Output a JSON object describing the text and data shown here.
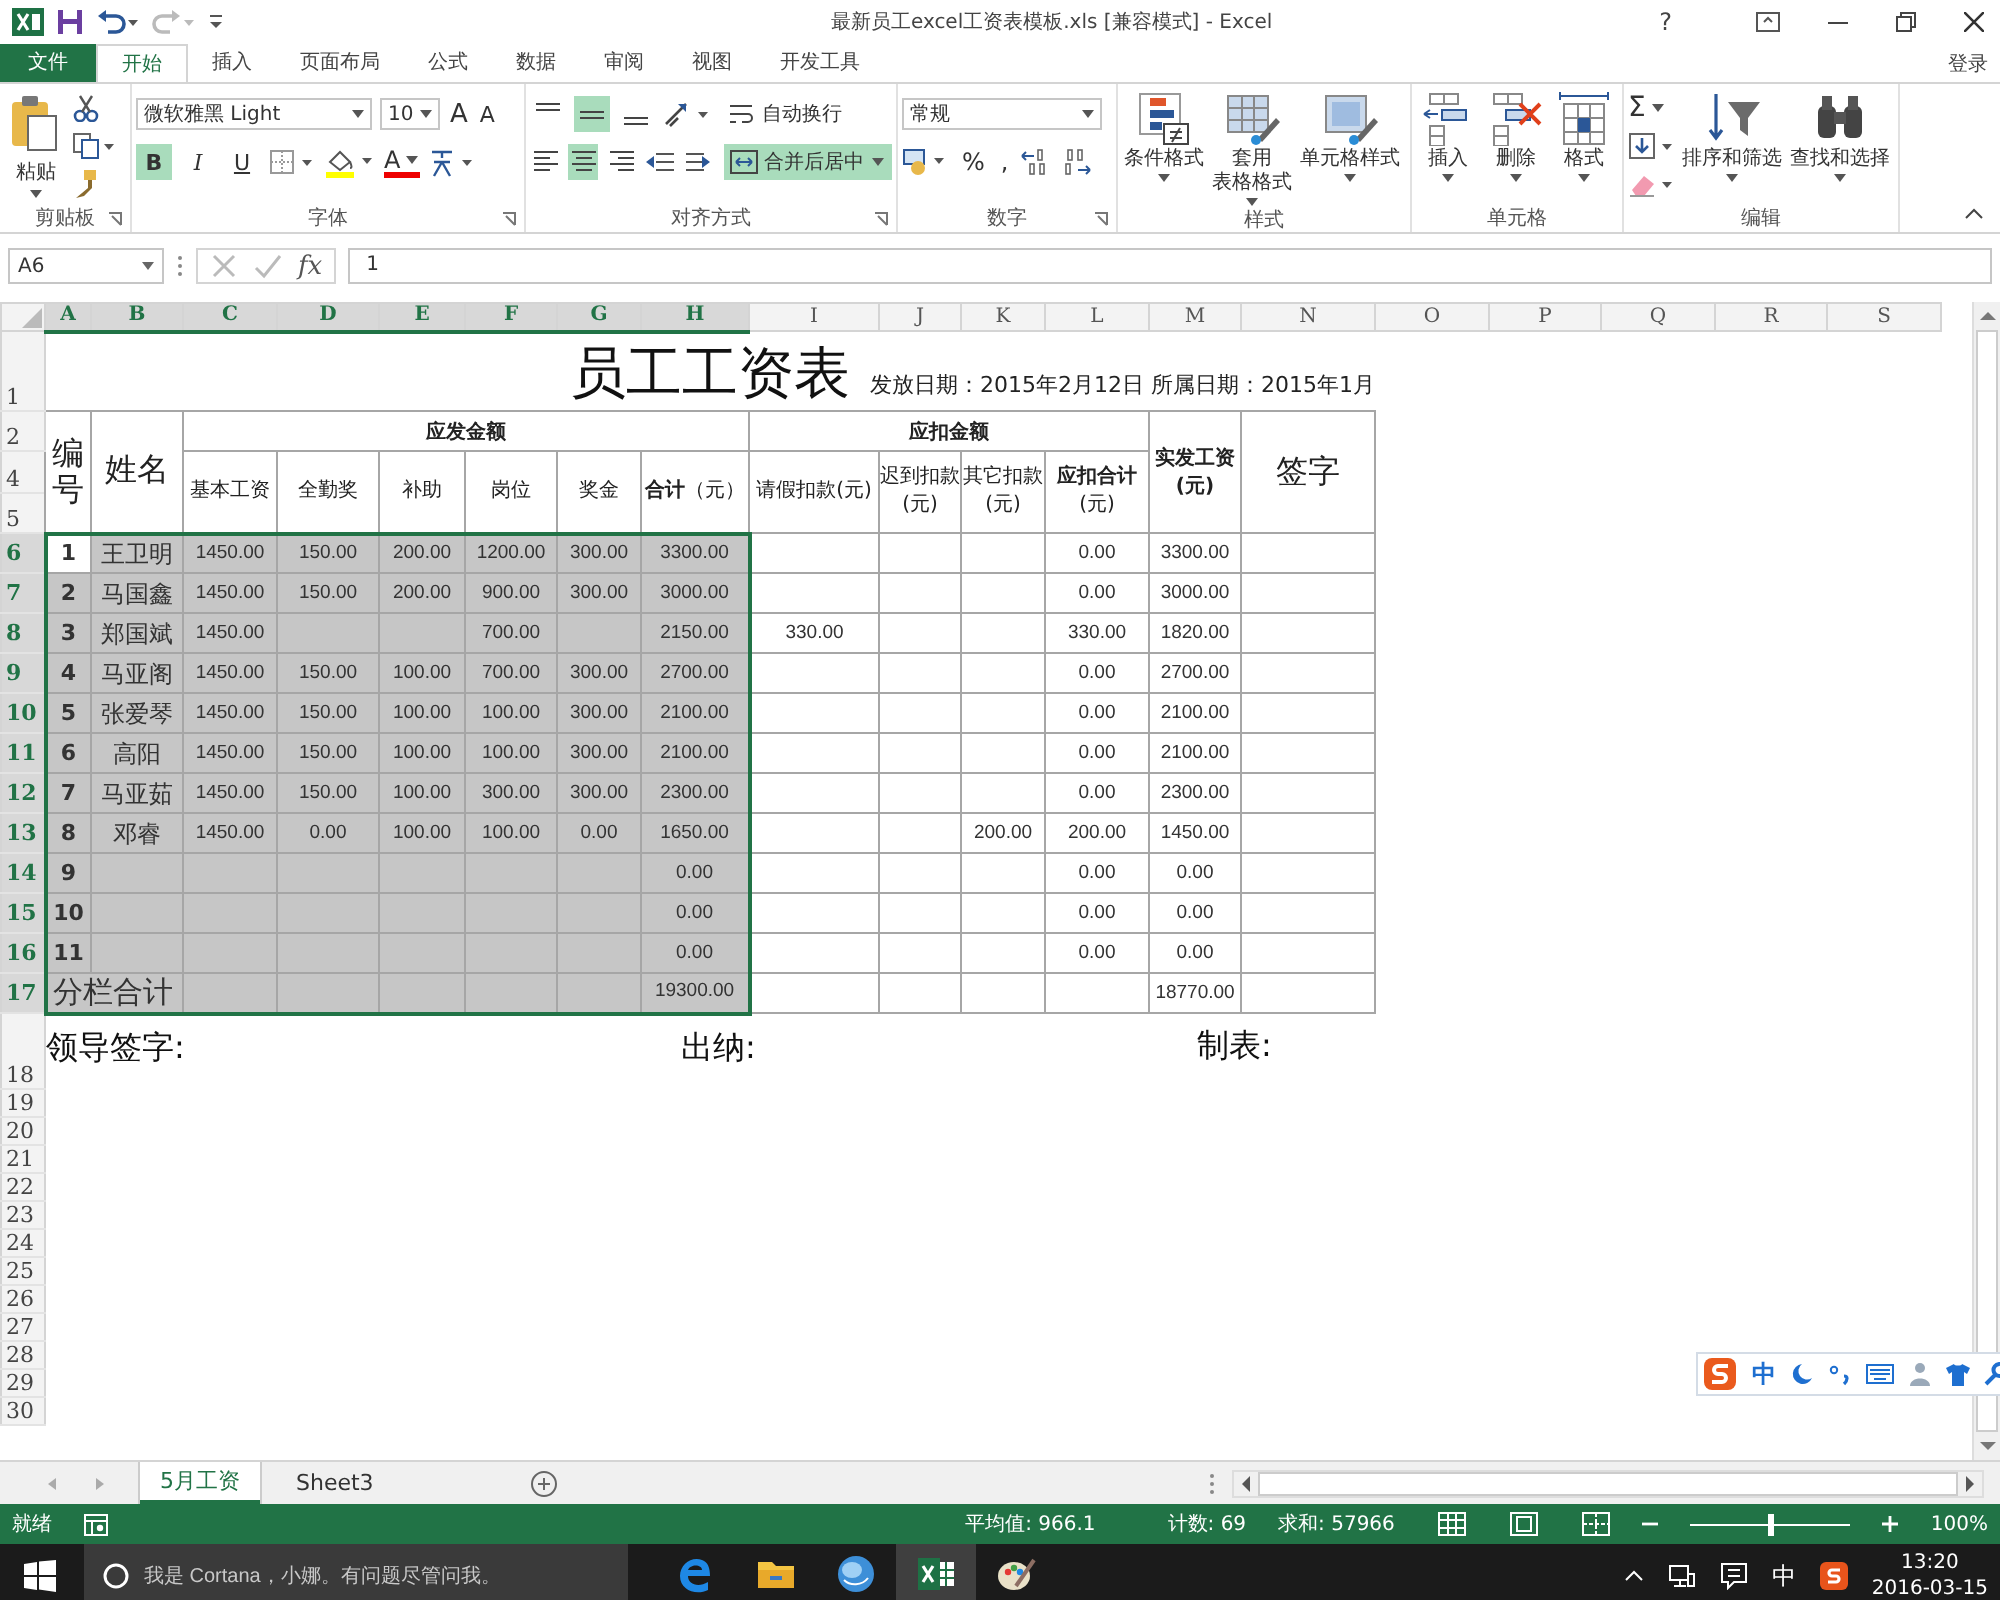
{
  "title_bar": {
    "title": "最新员工excel工资表模板.xls  [兼容模式] - Excel",
    "help": "?"
  },
  "ribbon_tabs": [
    {
      "label": "文件",
      "kind": "file",
      "selected": false
    },
    {
      "label": "开始",
      "kind": "tab",
      "selected": true
    },
    {
      "label": "插入",
      "kind": "tab",
      "selected": false
    },
    {
      "label": "页面布局",
      "kind": "tab",
      "selected": false
    },
    {
      "label": "公式",
      "kind": "tab",
      "selected": false
    },
    {
      "label": "数据",
      "kind": "tab",
      "selected": false
    },
    {
      "label": "审阅",
      "kind": "tab",
      "selected": false
    },
    {
      "label": "视图",
      "kind": "tab",
      "selected": false
    },
    {
      "label": "开发工具",
      "kind": "tab",
      "selected": false
    }
  ],
  "account": "登录",
  "ribbon": {
    "clipboard": {
      "label": "剪贴板",
      "paste": "粘贴"
    },
    "font": {
      "label": "字体",
      "font_name": "微软雅黑 Light",
      "font_size": "10",
      "grow_label": "A",
      "shrink_label": "A",
      "font_color_label": "A",
      "styles": [
        {
          "label": "B",
          "selected": true
        },
        {
          "label": "I",
          "selected": false
        },
        {
          "label": "U",
          "selected": false
        }
      ]
    },
    "alignment": {
      "label": "对齐方式",
      "vertical": [
        {
          "selected": false
        },
        {
          "selected": true
        },
        {
          "selected": false
        }
      ],
      "horizontal": [
        {
          "selected": false
        },
        {
          "selected": true
        },
        {
          "selected": false
        }
      ],
      "wrap": {
        "label": "自动换行",
        "selected": false
      },
      "merge": {
        "label": "合并后居中",
        "selected": true
      }
    },
    "number": {
      "label": "数字",
      "format": "常规",
      "percent": "%",
      "comma": ","
    },
    "styles": {
      "label": "样式",
      "buttons": [
        {
          "kind": "conditional",
          "lines": [
            "条件格式"
          ]
        },
        {
          "kind": "table",
          "lines": [
            "套用",
            "表格格式"
          ]
        },
        {
          "kind": "cell",
          "lines": [
            "单元格样式"
          ]
        }
      ]
    },
    "cells": {
      "label": "单元格",
      "buttons": [
        {
          "kind": "insert",
          "lines": [
            "插入"
          ]
        },
        {
          "kind": "delete",
          "lines": [
            "删除"
          ]
        },
        {
          "kind": "format",
          "lines": [
            "格式"
          ]
        }
      ]
    },
    "editing": {
      "label": "编辑",
      "sum": "Σ",
      "buttons": [
        {
          "kind": "sort",
          "lines": [
            "排序和筛选"
          ]
        },
        {
          "kind": "find",
          "lines": [
            "查找和选择"
          ]
        }
      ]
    }
  },
  "formula_bar": {
    "name_box": "A6",
    "fx": "fx",
    "value": "1"
  },
  "sheet": {
    "columns": [
      {
        "label": "A",
        "selected": true
      },
      {
        "label": "B",
        "selected": true
      },
      {
        "label": "C",
        "selected": true
      },
      {
        "label": "D",
        "selected": true
      },
      {
        "label": "E",
        "selected": true
      },
      {
        "label": "F",
        "selected": true
      },
      {
        "label": "G",
        "selected": true
      },
      {
        "label": "H",
        "selected": true
      },
      {
        "label": "I",
        "selected": false
      },
      {
        "label": "J",
        "selected": false
      },
      {
        "label": "K",
        "selected": false
      },
      {
        "label": "L",
        "selected": false
      },
      {
        "label": "M",
        "selected": false
      },
      {
        "label": "N",
        "selected": false
      },
      {
        "label": "O",
        "selected": false
      },
      {
        "label": "P",
        "selected": false
      },
      {
        "label": "Q",
        "selected": false
      },
      {
        "label": "R",
        "selected": false
      },
      {
        "label": "S",
        "selected": false
      }
    ],
    "title_row": {
      "row": "1",
      "title": "员工工资表",
      "info": "发放日期：2015年2月12日 所属日期：2015年1月"
    },
    "header": {
      "rows": [
        "2",
        "4",
        "5"
      ],
      "number": "编号",
      "name": "姓名",
      "payable": "应发金额",
      "payable_columns": [
        "基本工资",
        "全勤奖",
        "补助",
        "岗位",
        "奖金",
        "**合计**（元）"
      ],
      "deduct": "应扣金额",
      "deduct_columns": [
        "请假扣款(元)",
        "迟到扣款(元)",
        "其它扣款(元)",
        "**应扣合计**(元)"
      ],
      "net": "实发工资(元)",
      "sign": "签字"
    },
    "rows": [
      {
        "row": "6",
        "no": "1",
        "name": "王卫明",
        "base": "1450.00",
        "attendance": "150.00",
        "subsidy": "200.00",
        "post": "1200.00",
        "bonus": "300.00",
        "total": "3300.00",
        "deduct_total": "0.00",
        "net": "3300.00",
        "selected": true,
        "active": true
      },
      {
        "row": "7",
        "no": "2",
        "name": "马国鑫",
        "base": "1450.00",
        "attendance": "150.00",
        "subsidy": "200.00",
        "post": "900.00",
        "bonus": "300.00",
        "total": "3000.00",
        "deduct_total": "0.00",
        "net": "3000.00",
        "selected": true,
        "active": false
      },
      {
        "row": "8",
        "no": "3",
        "name": "郑国斌",
        "base": "1450.00",
        "post": "700.00",
        "total": "2150.00",
        "leave": "330.00",
        "deduct_total": "330.00",
        "net": "1820.00",
        "selected": true,
        "active": false
      },
      {
        "row": "9",
        "no": "4",
        "name": "马亚阁",
        "base": "1450.00",
        "attendance": "150.00",
        "subsidy": "100.00",
        "post": "700.00",
        "bonus": "300.00",
        "total": "2700.00",
        "deduct_total": "0.00",
        "net": "2700.00",
        "selected": true,
        "active": false
      },
      {
        "row": "10",
        "no": "5",
        "name": "张爱琴",
        "base": "1450.00",
        "attendance": "150.00",
        "subsidy": "100.00",
        "post": "100.00",
        "bonus": "300.00",
        "total": "2100.00",
        "deduct_total": "0.00",
        "net": "2100.00",
        "selected": true,
        "active": false
      },
      {
        "row": "11",
        "no": "6",
        "name": "高阳",
        "base": "1450.00",
        "attendance": "150.00",
        "subsidy": "100.00",
        "post": "100.00",
        "bonus": "300.00",
        "total": "2100.00",
        "deduct_total": "0.00",
        "net": "2100.00",
        "selected": true,
        "active": false
      },
      {
        "row": "12",
        "no": "7",
        "name": "马亚茹",
        "base": "1450.00",
        "attendance": "150.00",
        "subsidy": "100.00",
        "post": "300.00",
        "bonus": "300.00",
        "total": "2300.00",
        "deduct_total": "0.00",
        "net": "2300.00",
        "selected": true,
        "active": false
      },
      {
        "row": "13",
        "no": "8",
        "name": "邓睿",
        "base": "1450.00",
        "attendance": "0.00",
        "subsidy": "100.00",
        "post": "100.00",
        "bonus": "0.00",
        "total": "1650.00",
        "other": "200.00",
        "deduct_total": "200.00",
        "net": "1450.00",
        "selected": true,
        "active": false
      },
      {
        "row": "14",
        "no": "9",
        "total": "0.00",
        "deduct_total": "0.00",
        "net": "0.00",
        "selected": true,
        "active": false
      },
      {
        "row": "15",
        "no": "10",
        "total": "0.00",
        "deduct_total": "0.00",
        "net": "0.00",
        "selected": true,
        "active": false
      },
      {
        "row": "16",
        "no": "11",
        "total": "0.00",
        "deduct_total": "0.00",
        "net": "0.00",
        "selected": true,
        "active": false
      }
    ],
    "total_row": {
      "row": "17",
      "label": "分栏合计",
      "total": "19300.00",
      "net": "18770.00",
      "selected": true
    },
    "footer": {
      "row": "18",
      "leader": "领导签字:",
      "cashier": "出纳:",
      "preparer": "制表:"
    },
    "blank_rows": [
      "19",
      "20",
      "21",
      "22",
      "23",
      "24",
      "25",
      "26",
      "27",
      "28",
      "29",
      "30"
    ]
  },
  "sheet_tabs": [
    {
      "label": "5月工资",
      "selected": true
    },
    {
      "label": "Sheet3",
      "selected": false
    }
  ],
  "status_bar": {
    "ready": "就绪",
    "average": "平均值: 966.1",
    "count": "计数: 69",
    "sum": "求和: 57966",
    "zoom": "100%",
    "level": 0.5
  },
  "ime_toolbar": {
    "mode": "中"
  },
  "taskbar": {
    "search_placeholder": "我是 Cortana，小娜。有问题尽管问我。",
    "apps": [
      {
        "kind": "edge",
        "selected": false
      },
      {
        "kind": "folder",
        "selected": false
      },
      {
        "kind": "globe",
        "selected": false
      },
      {
        "kind": "excel",
        "selected": true
      },
      {
        "kind": "paint",
        "selected": false
      }
    ],
    "input_mode": "中",
    "time": "13:20",
    "date": "2016-03-15"
  }
}
